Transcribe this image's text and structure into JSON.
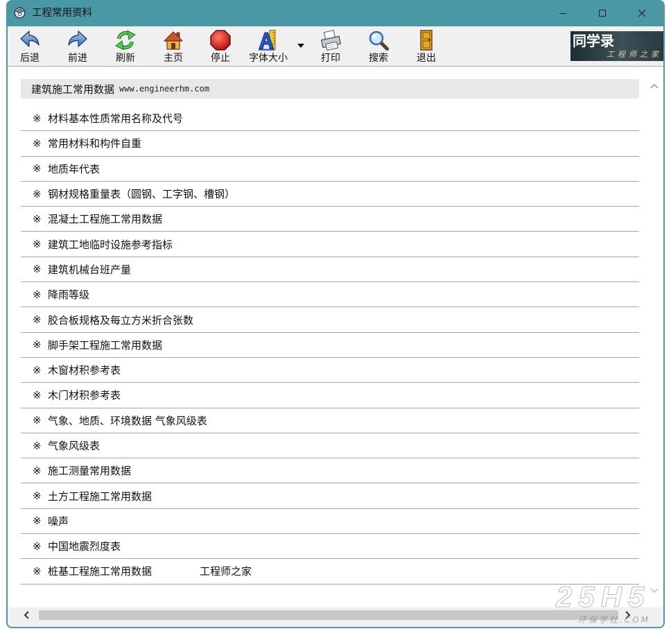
{
  "window": {
    "title": "工程常用资料",
    "title_icon": "app-disc-icon",
    "controls": [
      "minimize-icon",
      "maximize-icon",
      "close-icon"
    ],
    "accent_color": "#4a98a5"
  },
  "toolbar": {
    "buttons": [
      {
        "label": "后退",
        "icon": "back-arrow-icon"
      },
      {
        "label": "前进",
        "icon": "forward-arrow-icon"
      },
      {
        "label": "刷新",
        "icon": "refresh-icon"
      },
      {
        "label": "主页",
        "icon": "home-icon"
      },
      {
        "label": "停止",
        "icon": "stop-icon"
      },
      {
        "label": "字体大小",
        "icon": "font-size-icon"
      },
      {
        "label": "打印",
        "icon": "printer-icon"
      },
      {
        "label": "搜索",
        "icon": "search-icon"
      },
      {
        "label": "退出",
        "icon": "exit-door-icon"
      }
    ],
    "logo": {
      "title": "同学录",
      "subtitle": "工程师之家"
    }
  },
  "content": {
    "header": {
      "title": "建筑施工常用数据",
      "url": "www.engineerhm.com"
    },
    "bullet": "※",
    "items": [
      {
        "text": "材料基本性质常用名称及代号"
      },
      {
        "text": "常用材料和构件自重"
      },
      {
        "text": "地质年代表"
      },
      {
        "text": "钢材规格重量表（圆钢、工字钢、槽钢）"
      },
      {
        "text": "混凝土工程施工常用数据"
      },
      {
        "text": "建筑工地临时设施参考指标"
      },
      {
        "text": "建筑机械台班产量"
      },
      {
        "text": "降雨等级"
      },
      {
        "text": "胶合板规格及每立方米折合张数"
      },
      {
        "text": "脚手架工程施工常用数据"
      },
      {
        "text": "木窗材积参考表"
      },
      {
        "text": "木门材积参考表"
      },
      {
        "text": "气象、地质、环境数据 气象风级表"
      },
      {
        "text": "气象风级表"
      },
      {
        "text": "施工测量常用数据"
      },
      {
        "text": "土方工程施工常用数据"
      },
      {
        "text": "噪声"
      },
      {
        "text": "中国地震烈度表"
      },
      {
        "text": "桩基工程施工常用数据",
        "suffix": "工程师之家"
      }
    ]
  },
  "watermark": {
    "main": "25H5",
    "sub": "环保学社.COM"
  }
}
